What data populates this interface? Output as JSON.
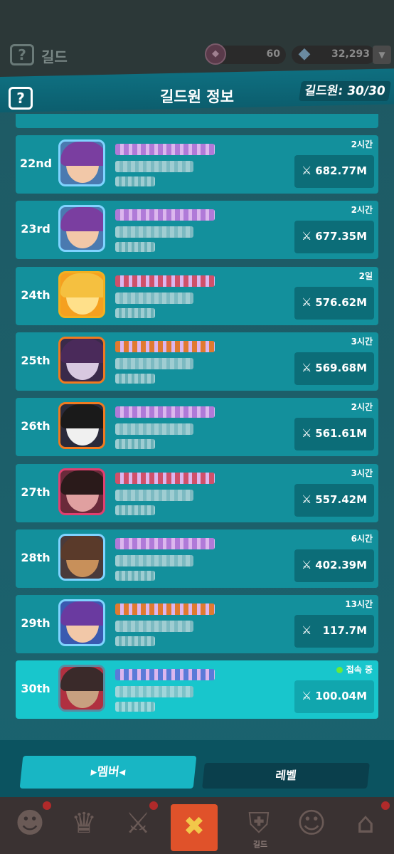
{
  "topbar": {
    "help_label": "?",
    "title": "길드",
    "resource1_value": "60",
    "resource2_value": "32,293",
    "more_label": "▼"
  },
  "header": {
    "help_label": "?",
    "title": "길드원 정보",
    "count": "길드원: 30/30"
  },
  "members": [
    {
      "rank": "22nd",
      "time": "2시간",
      "score": "682.77M",
      "name_color": "#b07ad8",
      "frame": "#7fd3ff",
      "hair": "#7a3ea0",
      "face": "#f2c8a8",
      "bg": "#4a7ab0",
      "online": false
    },
    {
      "rank": "23rd",
      "time": "2시간",
      "score": "677.35M",
      "name_color": "#b07ad8",
      "frame": "#7fd3ff",
      "hair": "#7a3ea0",
      "face": "#f2c8a8",
      "bg": "#4a7ab0",
      "online": false
    },
    {
      "rank": "24th",
      "time": "2일",
      "score": "576.62M",
      "name_color": "#d0506a",
      "frame": "#f2b020",
      "hair": "#f5c040",
      "face": "#ffe08a",
      "bg": "#f5a020",
      "online": false
    },
    {
      "rank": "25th",
      "time": "3시간",
      "score": "569.68M",
      "name_color": "#e07a30",
      "frame": "#f07a20",
      "hair": "#4a2a5a",
      "face": "#d8c8e0",
      "bg": "#3a2a4a",
      "online": false
    },
    {
      "rank": "26th",
      "time": "2시간",
      "score": "561.61M",
      "name_color": "#b07ad8",
      "frame": "#f07a20",
      "hair": "#1a1a1a",
      "face": "#f0f0f0",
      "bg": "#2a2a3a",
      "online": false
    },
    {
      "rank": "27th",
      "time": "3시간",
      "score": "557.42M",
      "name_color": "#d0506a",
      "frame": "#e04070",
      "hair": "#2a1a1a",
      "face": "#e0a0a0",
      "bg": "#6a2a3a",
      "online": false
    },
    {
      "rank": "28th",
      "time": "6시간",
      "score": "402.39M",
      "name_color": "#b07ad8",
      "frame": "#7fd3ff",
      "hair": "#5a3a2a",
      "face": "#c8905a",
      "bg": "#4a3a3a",
      "online": false
    },
    {
      "rank": "29th",
      "time": "13시간",
      "score": "117.7M",
      "name_color": "#e07a30",
      "frame": "#7fd3ff",
      "hair": "#6a3aa0",
      "face": "#f2c8a8",
      "bg": "#3a5ab0",
      "online": false
    },
    {
      "rank": "30th",
      "time": "접속 중",
      "score": "100.04M",
      "name_color": "#5a7ad8",
      "frame": "#5a8aa0",
      "hair": "#3a2a2a",
      "face": "#c8a080",
      "bg": "#b03040",
      "online": true
    }
  ],
  "tabs": {
    "member": "▸멤버◂",
    "level": "레벨"
  },
  "nav": {
    "close": "✖",
    "guild_label": "길드"
  },
  "icons": {
    "swords": "sword-icon",
    "diamond": "diamond-icon",
    "help": "help-icon"
  }
}
